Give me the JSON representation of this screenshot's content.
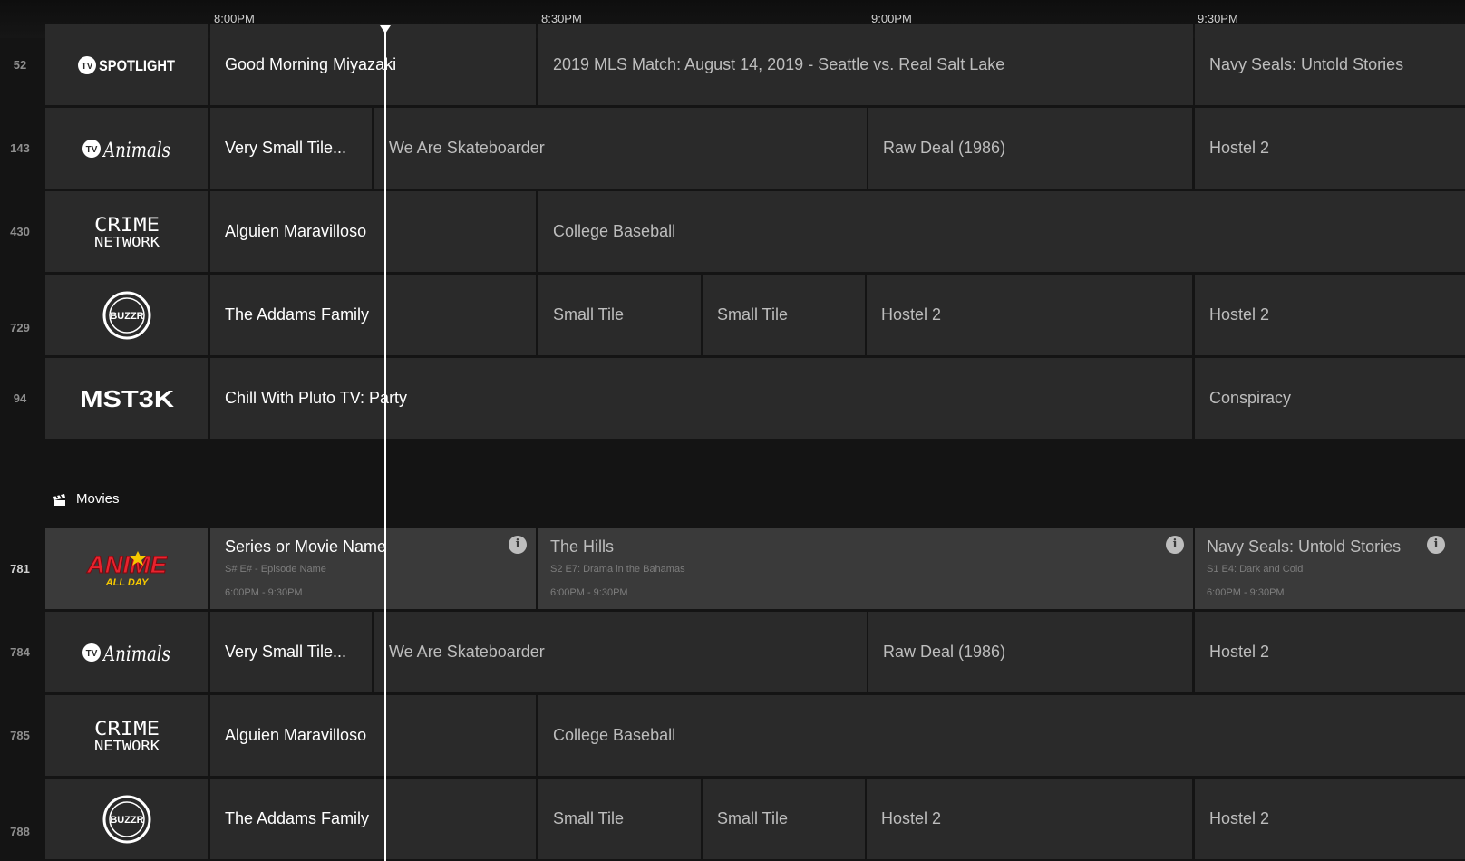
{
  "times": [
    "8:00PM",
    "8:30PM",
    "9:00PM",
    "9:30PM"
  ],
  "section": {
    "label": "Movies",
    "icon": "clapper-icon"
  },
  "rows_top": [
    {
      "num": "52",
      "logo": "TV SPOTLIGHT",
      "programs": [
        "Good Morning Miyazaki",
        "2019 MLS Match: August 14, 2019 - Seattle vs. Real Salt Lake",
        "Navy Seals: Untold Stories"
      ]
    },
    {
      "num": "143",
      "logo": "TV Animals",
      "programs": [
        "Very Small Tile...",
        "We Are Skateboarder",
        "Raw Deal  (1986)",
        "Hostel 2"
      ]
    },
    {
      "num": "430",
      "logo": "CRIME NETWORK",
      "programs": [
        "Alguien Maravilloso",
        "College Baseball"
      ]
    },
    {
      "num": "729",
      "logo": "BUZZR",
      "programs": [
        "The Addams Family",
        "Small Tile",
        "Small Tile",
        "Hostel 2",
        "Hostel 2"
      ]
    },
    {
      "num": "94",
      "logo": "MST3K",
      "programs": [
        "Chill With Pluto TV: Party",
        "Conspiracy"
      ]
    }
  ],
  "rows_bottom": [
    {
      "num": "781",
      "logo": "ANIME ALL DAY",
      "programs": [
        {
          "title": "Series or Movie Name",
          "sub": "S# E# - Episode Name",
          "time": "6:00PM - 9:30PM"
        },
        {
          "title": "The Hills",
          "sub": "S2 E7: Drama in the Bahamas",
          "time": "6:00PM - 9:30PM"
        },
        {
          "title": "Navy Seals: Untold Stories",
          "sub": "S1 E4: Dark and Cold",
          "time": "6:00PM - 9:30PM"
        }
      ]
    },
    {
      "num": "784",
      "logo": "TV Animals",
      "programs": [
        "Very Small Tile...",
        "We Are Skateboarder",
        "Raw Deal  (1986)",
        "Hostel 2"
      ]
    },
    {
      "num": "785",
      "logo": "CRIME NETWORK",
      "programs": [
        "Alguien Maravilloso",
        "College Baseball"
      ]
    },
    {
      "num": "788",
      "logo": "BUZZR",
      "programs": [
        "The Addams Family",
        "Small Tile",
        "Small Tile",
        "Hostel 2",
        "Hostel 2"
      ]
    }
  ],
  "colors": {
    "background": "#141414",
    "tile": "#2a2a2a",
    "tile_selected": "#3a3a3a",
    "now_line": "#ffffff"
  }
}
